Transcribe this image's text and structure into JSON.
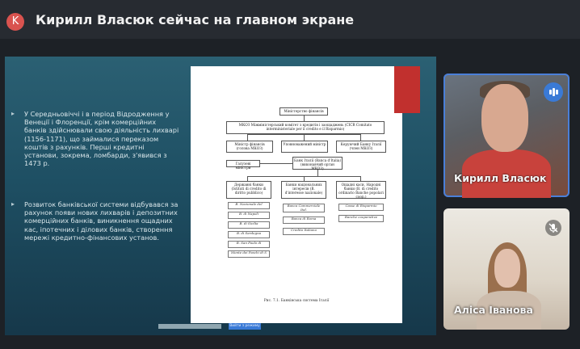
{
  "header": {
    "avatar_letter": "K",
    "title": "Кирилл Власюк сейчас на главном экране"
  },
  "slide": {
    "bullets": [
      "У Середньовіччі і в період Відродження у Венеції і Флоренції, крім комерційних банків здійснювали свою діяльність лихварі (1156-1171), що займалися переказом коштів з рахунків. Перші кредитні установи, зокрема, ломбарди, з'явився з 1473 р.",
      "Розвиток банківської системи відбувався за рахунок появи нових лихварів і депозитних комерційних банків, виникнення ощадних кас, іпотечних і ділових банків, створення мережі кредитно-фінансових установ."
    ],
    "diagram": {
      "top": "Міністерство фінансів",
      "committee": "МКОЗ Міжміністерський комітет з кредитів і заощаджень (CICR Comitato interministeriale per il credito e il Risparmio)",
      "level2": [
        "Міністр фінансів (голова МКОЗ)",
        "Уповноважений міністр",
        "Керуючий Банку Італії (член МКОЗ)"
      ],
      "ministers": "Галузеві міністри",
      "central_bank": "Банк Італії (Banca d'Italia) (виконавчий орган МКОЗ)",
      "columns": [
        {
          "header": "Державні банки (Istituti di credito di diritto pubblico)",
          "items": [
            "B. Nazionale del",
            "B. di Napoli",
            "B. di Sicilia",
            "B. di Sardegna",
            "B. San Paolo di",
            "Monte dei Paschi di S"
          ]
        },
        {
          "header": "Банки національних інтересів (B. d'interesse nazionale)",
          "items": [
            "Banca Commerciale Ital.",
            "Banca di Roma",
            "Credito Italiano"
          ]
        },
        {
          "header": "Ощадні каси, Народні банки (B. di credito ordinario Banche popolari coop.)",
          "items": [
            "Casse di Risparmio",
            "Banche cooperative"
          ]
        }
      ],
      "caption": "Рис. 7.1. Банківська система Італії"
    },
    "footer_button": "Вийти з режиму"
  },
  "participants": [
    {
      "name": "Кирилл Власюк",
      "state": "speaking"
    },
    {
      "name": "Аліса Іванова",
      "state": "muted"
    }
  ],
  "colors": {
    "accent": "#3a7ad6",
    "avatar": "#d9534f",
    "slide_accent": "#c1302e"
  },
  "icons": [
    "speaking-indicator-icon",
    "mic-off-icon"
  ]
}
